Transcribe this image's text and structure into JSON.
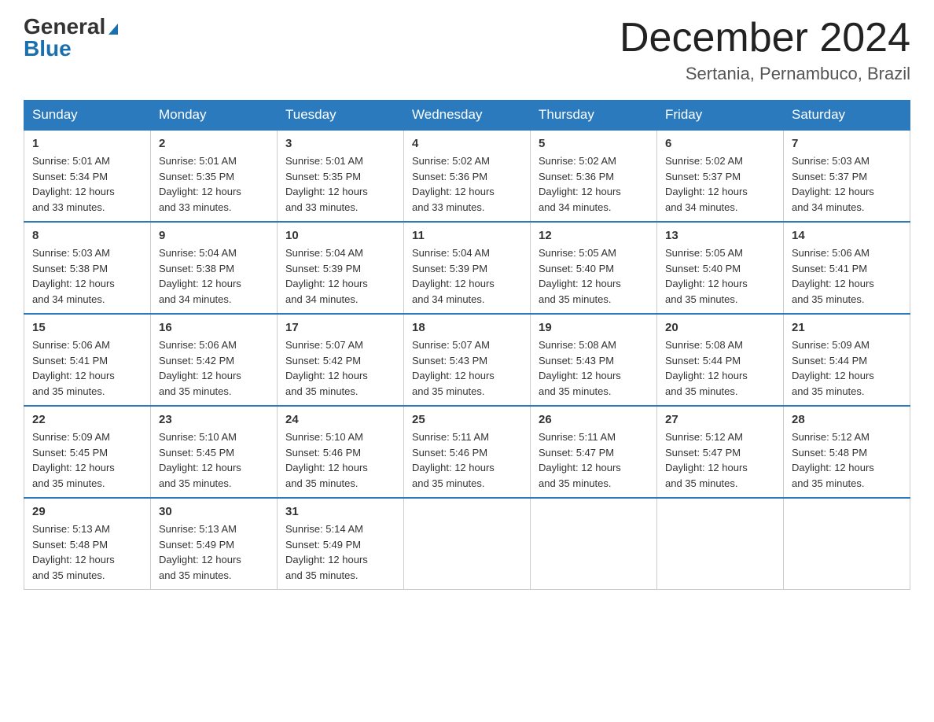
{
  "logo": {
    "general": "General",
    "blue": "Blue"
  },
  "title": "December 2024",
  "location": "Sertania, Pernambuco, Brazil",
  "days_of_week": [
    "Sunday",
    "Monday",
    "Tuesday",
    "Wednesday",
    "Thursday",
    "Friday",
    "Saturday"
  ],
  "weeks": [
    [
      {
        "day": "1",
        "sunrise": "5:01 AM",
        "sunset": "5:34 PM",
        "daylight": "12 hours and 33 minutes."
      },
      {
        "day": "2",
        "sunrise": "5:01 AM",
        "sunset": "5:35 PM",
        "daylight": "12 hours and 33 minutes."
      },
      {
        "day": "3",
        "sunrise": "5:01 AM",
        "sunset": "5:35 PM",
        "daylight": "12 hours and 33 minutes."
      },
      {
        "day": "4",
        "sunrise": "5:02 AM",
        "sunset": "5:36 PM",
        "daylight": "12 hours and 33 minutes."
      },
      {
        "day": "5",
        "sunrise": "5:02 AM",
        "sunset": "5:36 PM",
        "daylight": "12 hours and 34 minutes."
      },
      {
        "day": "6",
        "sunrise": "5:02 AM",
        "sunset": "5:37 PM",
        "daylight": "12 hours and 34 minutes."
      },
      {
        "day": "7",
        "sunrise": "5:03 AM",
        "sunset": "5:37 PM",
        "daylight": "12 hours and 34 minutes."
      }
    ],
    [
      {
        "day": "8",
        "sunrise": "5:03 AM",
        "sunset": "5:38 PM",
        "daylight": "12 hours and 34 minutes."
      },
      {
        "day": "9",
        "sunrise": "5:04 AM",
        "sunset": "5:38 PM",
        "daylight": "12 hours and 34 minutes."
      },
      {
        "day": "10",
        "sunrise": "5:04 AM",
        "sunset": "5:39 PM",
        "daylight": "12 hours and 34 minutes."
      },
      {
        "day": "11",
        "sunrise": "5:04 AM",
        "sunset": "5:39 PM",
        "daylight": "12 hours and 34 minutes."
      },
      {
        "day": "12",
        "sunrise": "5:05 AM",
        "sunset": "5:40 PM",
        "daylight": "12 hours and 35 minutes."
      },
      {
        "day": "13",
        "sunrise": "5:05 AM",
        "sunset": "5:40 PM",
        "daylight": "12 hours and 35 minutes."
      },
      {
        "day": "14",
        "sunrise": "5:06 AM",
        "sunset": "5:41 PM",
        "daylight": "12 hours and 35 minutes."
      }
    ],
    [
      {
        "day": "15",
        "sunrise": "5:06 AM",
        "sunset": "5:41 PM",
        "daylight": "12 hours and 35 minutes."
      },
      {
        "day": "16",
        "sunrise": "5:06 AM",
        "sunset": "5:42 PM",
        "daylight": "12 hours and 35 minutes."
      },
      {
        "day": "17",
        "sunrise": "5:07 AM",
        "sunset": "5:42 PM",
        "daylight": "12 hours and 35 minutes."
      },
      {
        "day": "18",
        "sunrise": "5:07 AM",
        "sunset": "5:43 PM",
        "daylight": "12 hours and 35 minutes."
      },
      {
        "day": "19",
        "sunrise": "5:08 AM",
        "sunset": "5:43 PM",
        "daylight": "12 hours and 35 minutes."
      },
      {
        "day": "20",
        "sunrise": "5:08 AM",
        "sunset": "5:44 PM",
        "daylight": "12 hours and 35 minutes."
      },
      {
        "day": "21",
        "sunrise": "5:09 AM",
        "sunset": "5:44 PM",
        "daylight": "12 hours and 35 minutes."
      }
    ],
    [
      {
        "day": "22",
        "sunrise": "5:09 AM",
        "sunset": "5:45 PM",
        "daylight": "12 hours and 35 minutes."
      },
      {
        "day": "23",
        "sunrise": "5:10 AM",
        "sunset": "5:45 PM",
        "daylight": "12 hours and 35 minutes."
      },
      {
        "day": "24",
        "sunrise": "5:10 AM",
        "sunset": "5:46 PM",
        "daylight": "12 hours and 35 minutes."
      },
      {
        "day": "25",
        "sunrise": "5:11 AM",
        "sunset": "5:46 PM",
        "daylight": "12 hours and 35 minutes."
      },
      {
        "day": "26",
        "sunrise": "5:11 AM",
        "sunset": "5:47 PM",
        "daylight": "12 hours and 35 minutes."
      },
      {
        "day": "27",
        "sunrise": "5:12 AM",
        "sunset": "5:47 PM",
        "daylight": "12 hours and 35 minutes."
      },
      {
        "day": "28",
        "sunrise": "5:12 AM",
        "sunset": "5:48 PM",
        "daylight": "12 hours and 35 minutes."
      }
    ],
    [
      {
        "day": "29",
        "sunrise": "5:13 AM",
        "sunset": "5:48 PM",
        "daylight": "12 hours and 35 minutes."
      },
      {
        "day": "30",
        "sunrise": "5:13 AM",
        "sunset": "5:49 PM",
        "daylight": "12 hours and 35 minutes."
      },
      {
        "day": "31",
        "sunrise": "5:14 AM",
        "sunset": "5:49 PM",
        "daylight": "12 hours and 35 minutes."
      },
      null,
      null,
      null,
      null
    ]
  ],
  "labels": {
    "sunrise": "Sunrise:",
    "sunset": "Sunset:",
    "daylight": "Daylight:"
  }
}
